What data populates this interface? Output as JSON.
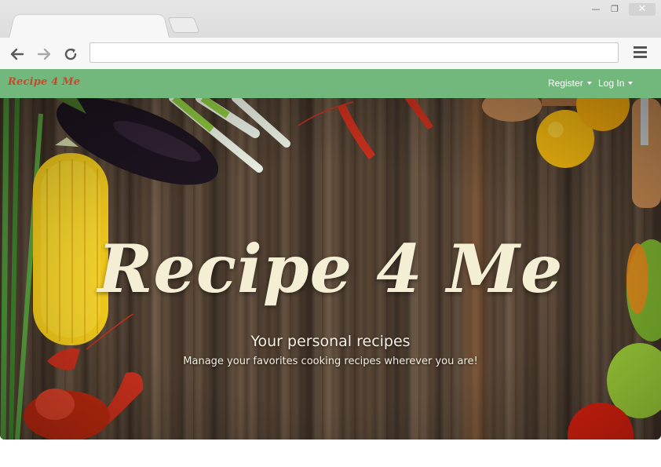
{
  "browser": {
    "address_value": "",
    "window_controls": {
      "minimize": "—",
      "restore": "❐",
      "close": "✕"
    },
    "icons": {
      "back": "arrow-left-icon",
      "forward": "arrow-right-icon",
      "reload": "reload-icon",
      "menu": "hamburger-menu-icon"
    }
  },
  "navbar": {
    "brand": "Recipe 4 Me",
    "register_label": "Register",
    "login_label": "Log In",
    "background_color": "#72b87c",
    "brand_color": "#c7492f"
  },
  "hero": {
    "title": "Recipe 4 Me",
    "subtitle": "Your personal recipes",
    "tagline": "Manage your favorites cooking recipes wherever you are!",
    "title_color": "#f4efd4"
  }
}
